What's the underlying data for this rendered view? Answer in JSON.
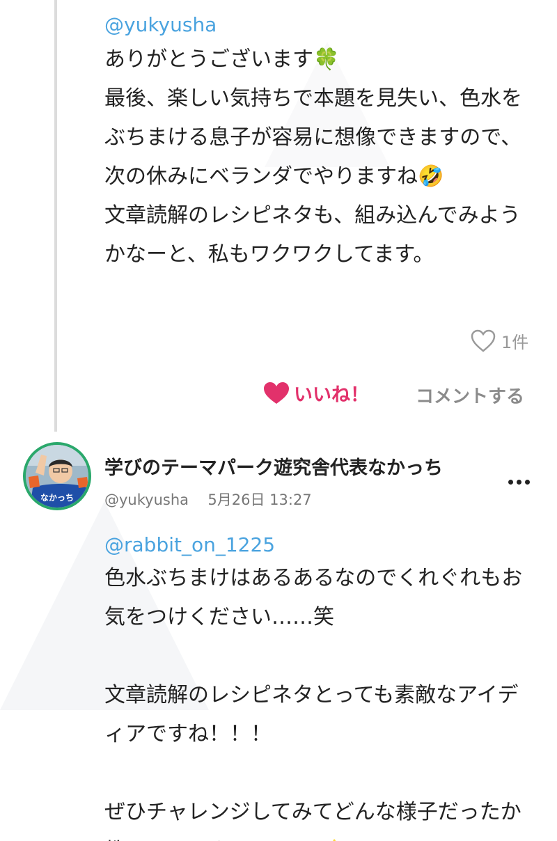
{
  "comment1": {
    "mention": "@yukyusha",
    "paragraphs": [
      "ありがとうございます🍀\n最後、楽しい気持ちで本題を見失い、色水をぶちまける息子が容易に想像できますので、次の休みにベランダでやりますね🤣\n文章読解のレシピネタも、組み込んでみようかなーと、私もワクワクしてます。"
    ],
    "like_count": "1件"
  },
  "actions": {
    "like_label": "いいね！",
    "comment_label": "コメントする"
  },
  "comment2": {
    "author_name": "学びのテーマパーク遊究舎代表なかっち",
    "handle": "@yukyusha",
    "timestamp": "5月26日 13:27",
    "mention": "@rabbit_on_1225",
    "paragraphs": [
      "色水ぶちまけはあるあるなのでくれぐれもお気をつけください……笑",
      "文章読解のレシピネタとっても素敵なアイディアですね！！！",
      "ぜひチャレンジしてみてどんな様子だったか教えてください(*´∀`*)🌟"
    ],
    "avatar_text": "なかっち"
  },
  "colors": {
    "mention": "#4aa3df",
    "like_accent": "#e2316b",
    "avatar_ring": "#2aa86b"
  },
  "icons": {
    "like_count": "heart-outline-icon",
    "like_button": "heart-filled-icon",
    "more": "more-dots-icon"
  }
}
